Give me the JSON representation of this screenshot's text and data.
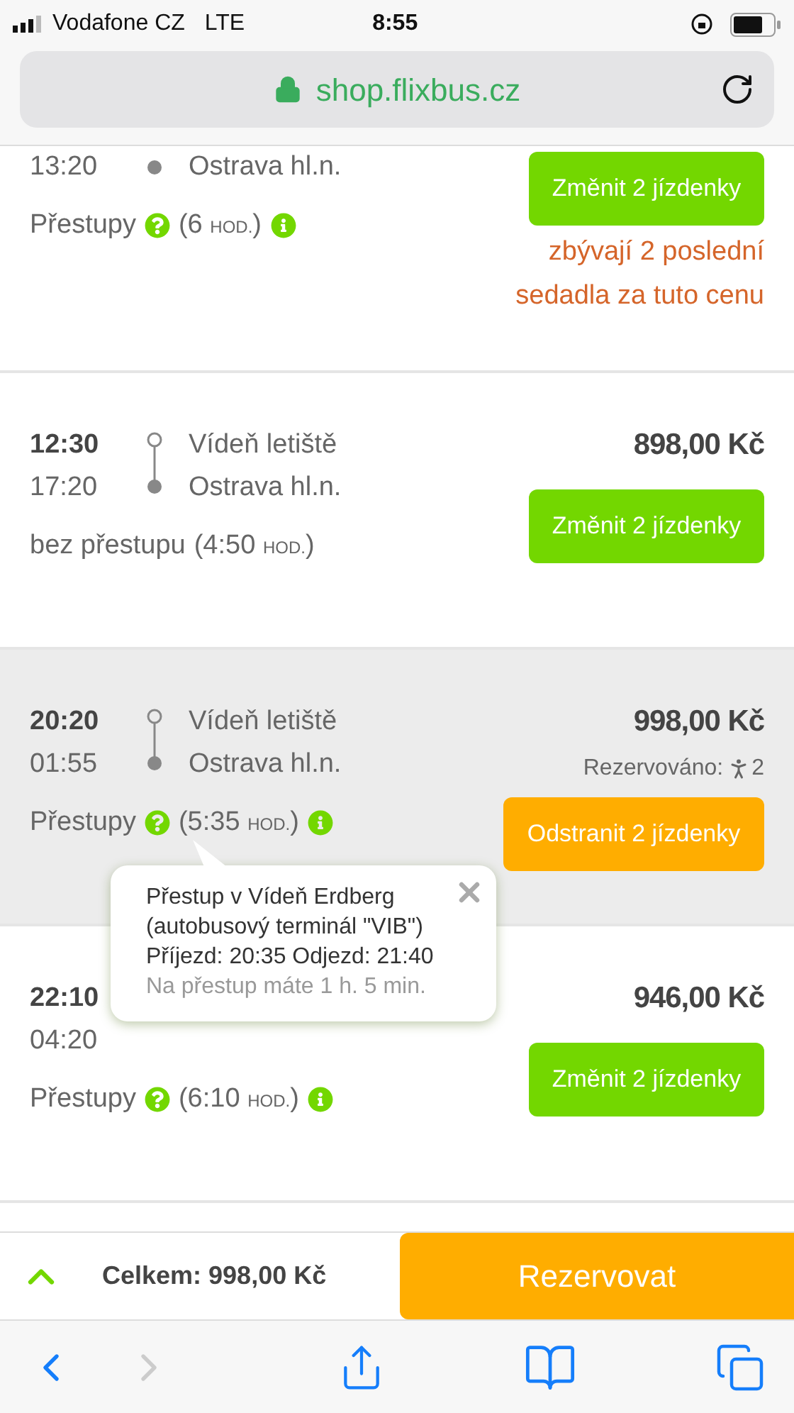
{
  "status_bar": {
    "carrier": "Vodafone CZ",
    "network": "LTE",
    "time": "8:55"
  },
  "url_bar": {
    "url": "shop.flixbus.cz"
  },
  "connections": [
    {
      "selected": false,
      "arrival": "13:20",
      "to": "Ostrava hl.n.",
      "kind": "transfers",
      "transfers_label": "Přestupy",
      "duration": "(6",
      "unit": "HOD.",
      "close": ")",
      "button": {
        "label": "Změnit 2 jízdenky",
        "kind": "change"
      },
      "note": "zbývají 2 poslední sedadla za tuto cenu"
    },
    {
      "selected": false,
      "departure": "12:30",
      "arrival": "17:20",
      "from": "Vídeň letiště",
      "to": "Ostrava hl.n.",
      "kind": "direct",
      "transfers_label": "bez přestupu",
      "duration": "(4:50",
      "unit": "HOD.",
      "close": ")",
      "price": "898,00 Kč",
      "button": {
        "label": "Změnit 2 jízdenky",
        "kind": "change"
      }
    },
    {
      "selected": true,
      "departure": "20:20",
      "arrival": "01:55",
      "from": "Vídeň letiště",
      "to": "Ostrava hl.n.",
      "kind": "transfers",
      "transfers_label": "Přestupy",
      "duration": "(5:35",
      "unit": "HOD.",
      "close": ")",
      "price": "998,00 Kč",
      "reserved": "Rezervováno:",
      "reserved_count": "2",
      "button": {
        "label": "Odstranit 2 jízdenky",
        "kind": "remove"
      }
    },
    {
      "selected": false,
      "departure": "22:10",
      "arrival": "04:20",
      "kind": "transfers",
      "transfers_label": "Přestupy",
      "duration": "(6:10",
      "unit": "HOD.",
      "close": ")",
      "price": "946,00 Kč",
      "button": {
        "label": "Změnit 2 jízdenky",
        "kind": "change"
      }
    }
  ],
  "tooltip": {
    "text": "Přestup v Vídeň Erdberg (autobusový terminál \"VIB\") Příjezd: 20:35 Odjezd: 21:40",
    "note": "Na přestup máte 1 h. 5 min."
  },
  "footer": {
    "total": "Celkem: 998,00 Kč",
    "button": "Rezervovat"
  },
  "toolbar": {
    "back_enabled": true,
    "forward_enabled": false
  }
}
